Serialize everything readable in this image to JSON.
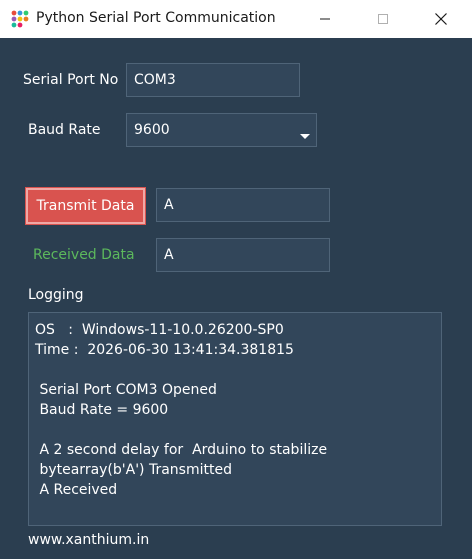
{
  "window": {
    "title": "Python Serial Port Communication"
  },
  "form": {
    "port_label": "Serial Port No",
    "port_value": "COM3",
    "baud_label": "Baud Rate",
    "baud_value": "9600",
    "transmit_label": "Transmit Data",
    "transmit_value": "A",
    "received_label": "Received Data",
    "received_value": "A"
  },
  "logging": {
    "label": "Logging",
    "lines": [
      "OS   :  Windows-11-10.0.26200-SP0",
      "Time :  2026-06-30 13:41:34.381815",
      "",
      " Serial Port COM3 Opened",
      " Baud Rate = 9600",
      "",
      " A 2 second delay for  Arduino to stabilize",
      " bytearray(b'A') Transmitted",
      " A Received"
    ]
  },
  "footer": {
    "link": "www.xanthium.in"
  },
  "colors": {
    "background": "#2b3e50",
    "field_bg": "#32465a",
    "field_border": "#4f6478",
    "button_red": "#d9534f",
    "received_green": "#5cb85c"
  },
  "icons": {
    "app": "colored-dots-app-icon",
    "minimize": "minimize-icon",
    "maximize": "maximize-icon",
    "close": "close-icon",
    "combo": "chevron-down-icon"
  }
}
